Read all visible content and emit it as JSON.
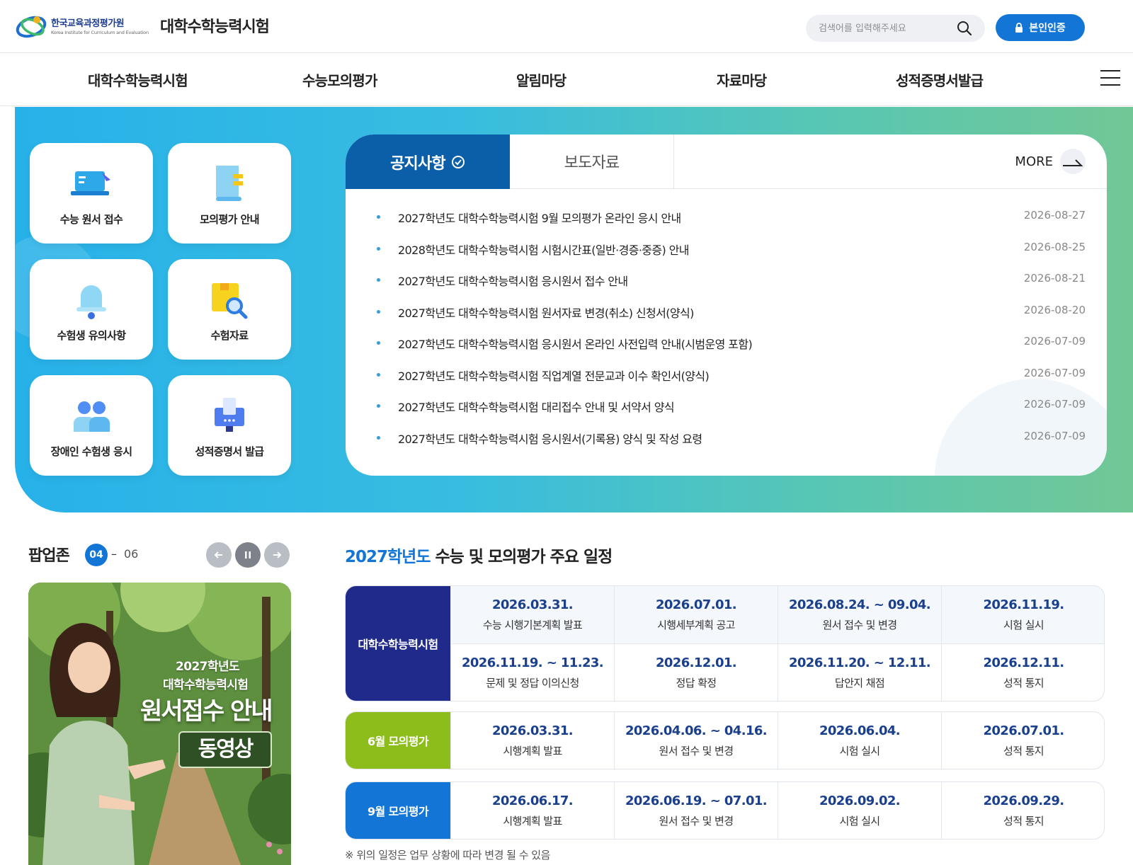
{
  "header": {
    "org_name_ko": "한국교육과정평가원",
    "org_name_en": "Korea Institute for Curriculum and Evaluation",
    "site_title": "대학수학능력시험",
    "search_placeholder": "검색어를 입력해주세요",
    "auth_button": "본인인증"
  },
  "nav": {
    "items": [
      "대학수학능력시험",
      "수능모의평가",
      "알림마당",
      "자료마당",
      "성적증명서발급"
    ]
  },
  "quick_links": [
    {
      "label": "수능 원서 접수",
      "icon": "laptop-icon"
    },
    {
      "label": "모의평가 안내",
      "icon": "document-icon"
    },
    {
      "label": "수험생 유의사항",
      "icon": "bell-icon"
    },
    {
      "label": "수험자료",
      "icon": "folder-search-icon"
    },
    {
      "label": "장애인 수험생 응시",
      "icon": "people-icon"
    },
    {
      "label": "성적증명서 발급",
      "icon": "certificate-icon"
    }
  ],
  "notice": {
    "tab_active": "공지사항",
    "tab_inactive": "보도자료",
    "more_label": "MORE",
    "items": [
      {
        "title": "2027학년도 대학수학능력시험 9월 모의평가 온라인 응시 안내",
        "date": "2026-08-27"
      },
      {
        "title": "2028학년도 대학수학능력시험 시험시간표(일반·경증·중증) 안내",
        "date": "2026-08-25"
      },
      {
        "title": "2027학년도 대학수학능력시험 응시원서 접수 안내",
        "date": "2026-08-21"
      },
      {
        "title": "2027학년도 대학수학능력시험 원서자료 변경(취소) 신청서(양식)",
        "date": "2026-08-20"
      },
      {
        "title": "2027학년도 대학수학능력시험 응시원서 온라인 사전입력 안내(시범운영 포함)",
        "date": "2026-07-09"
      },
      {
        "title": "2027학년도 대학수학능력시험 직업계열 전문교과 이수 확인서(양식)",
        "date": "2026-07-09"
      },
      {
        "title": "2027학년도 대학수학능력시험 대리접수 안내 및 서약서 양식",
        "date": "2026-07-09"
      },
      {
        "title": "2027학년도 대학수학능력시험 응시원서(기록용) 양식 및 작성 요령",
        "date": "2026-07-09"
      }
    ]
  },
  "popup": {
    "title": "팝업존",
    "current": "04",
    "separator": "–",
    "total": "06",
    "line1": "2027학년도",
    "line2": "대학수학능력시험",
    "headline": "원서접수 안내",
    "tag": "동영상"
  },
  "schedule": {
    "title_highlight": "2027학년도",
    "title_rest": " 수능 및 모의평가 주요 일정",
    "groups": [
      {
        "label": "대학수학능력시험",
        "color": "#1f2a8a",
        "rows": [
          [
            {
              "date": "2026.03.31.",
              "desc": "수능 시행기본계획 발표"
            },
            {
              "date": "2026.07.01.",
              "desc": "시행세부계획 공고"
            },
            {
              "date": "2026.08.24. ~ 09.04.",
              "desc": "원서 접수 및 변경"
            },
            {
              "date": "2026.11.19.",
              "desc": "시험 실시"
            }
          ],
          [
            {
              "date": "2026.11.19. ~ 11.23.",
              "desc": "문제 및 정답 이의신청"
            },
            {
              "date": "2026.12.01.",
              "desc": "정답 확정"
            },
            {
              "date": "2026.11.20. ~ 12.11.",
              "desc": "답안지 채점"
            },
            {
              "date": "2026.12.11.",
              "desc": "성적 통지"
            }
          ]
        ]
      },
      {
        "label": "6월 모의평가",
        "color": "#8cbd1a",
        "rows": [
          [
            {
              "date": "2026.03.31.",
              "desc": "시행계획 발표"
            },
            {
              "date": "2026.04.06. ~ 04.16.",
              "desc": "원서 접수 및 변경"
            },
            {
              "date": "2026.06.04.",
              "desc": "시험 실시"
            },
            {
              "date": "2026.07.01.",
              "desc": "성적 통지"
            }
          ]
        ]
      },
      {
        "label": "9월 모의평가",
        "color": "#1376d6",
        "rows": [
          [
            {
              "date": "2026.06.17.",
              "desc": "시행계획 발표"
            },
            {
              "date": "2026.06.19. ~ 07.01.",
              "desc": "원서 접수 및 변경"
            },
            {
              "date": "2026.09.02.",
              "desc": "시험 실시"
            },
            {
              "date": "2026.09.29.",
              "desc": "성적 통지"
            }
          ]
        ]
      }
    ],
    "footnote": "※ 위의 일정은 업무 상황에 따라 변경 될 수 있음"
  }
}
